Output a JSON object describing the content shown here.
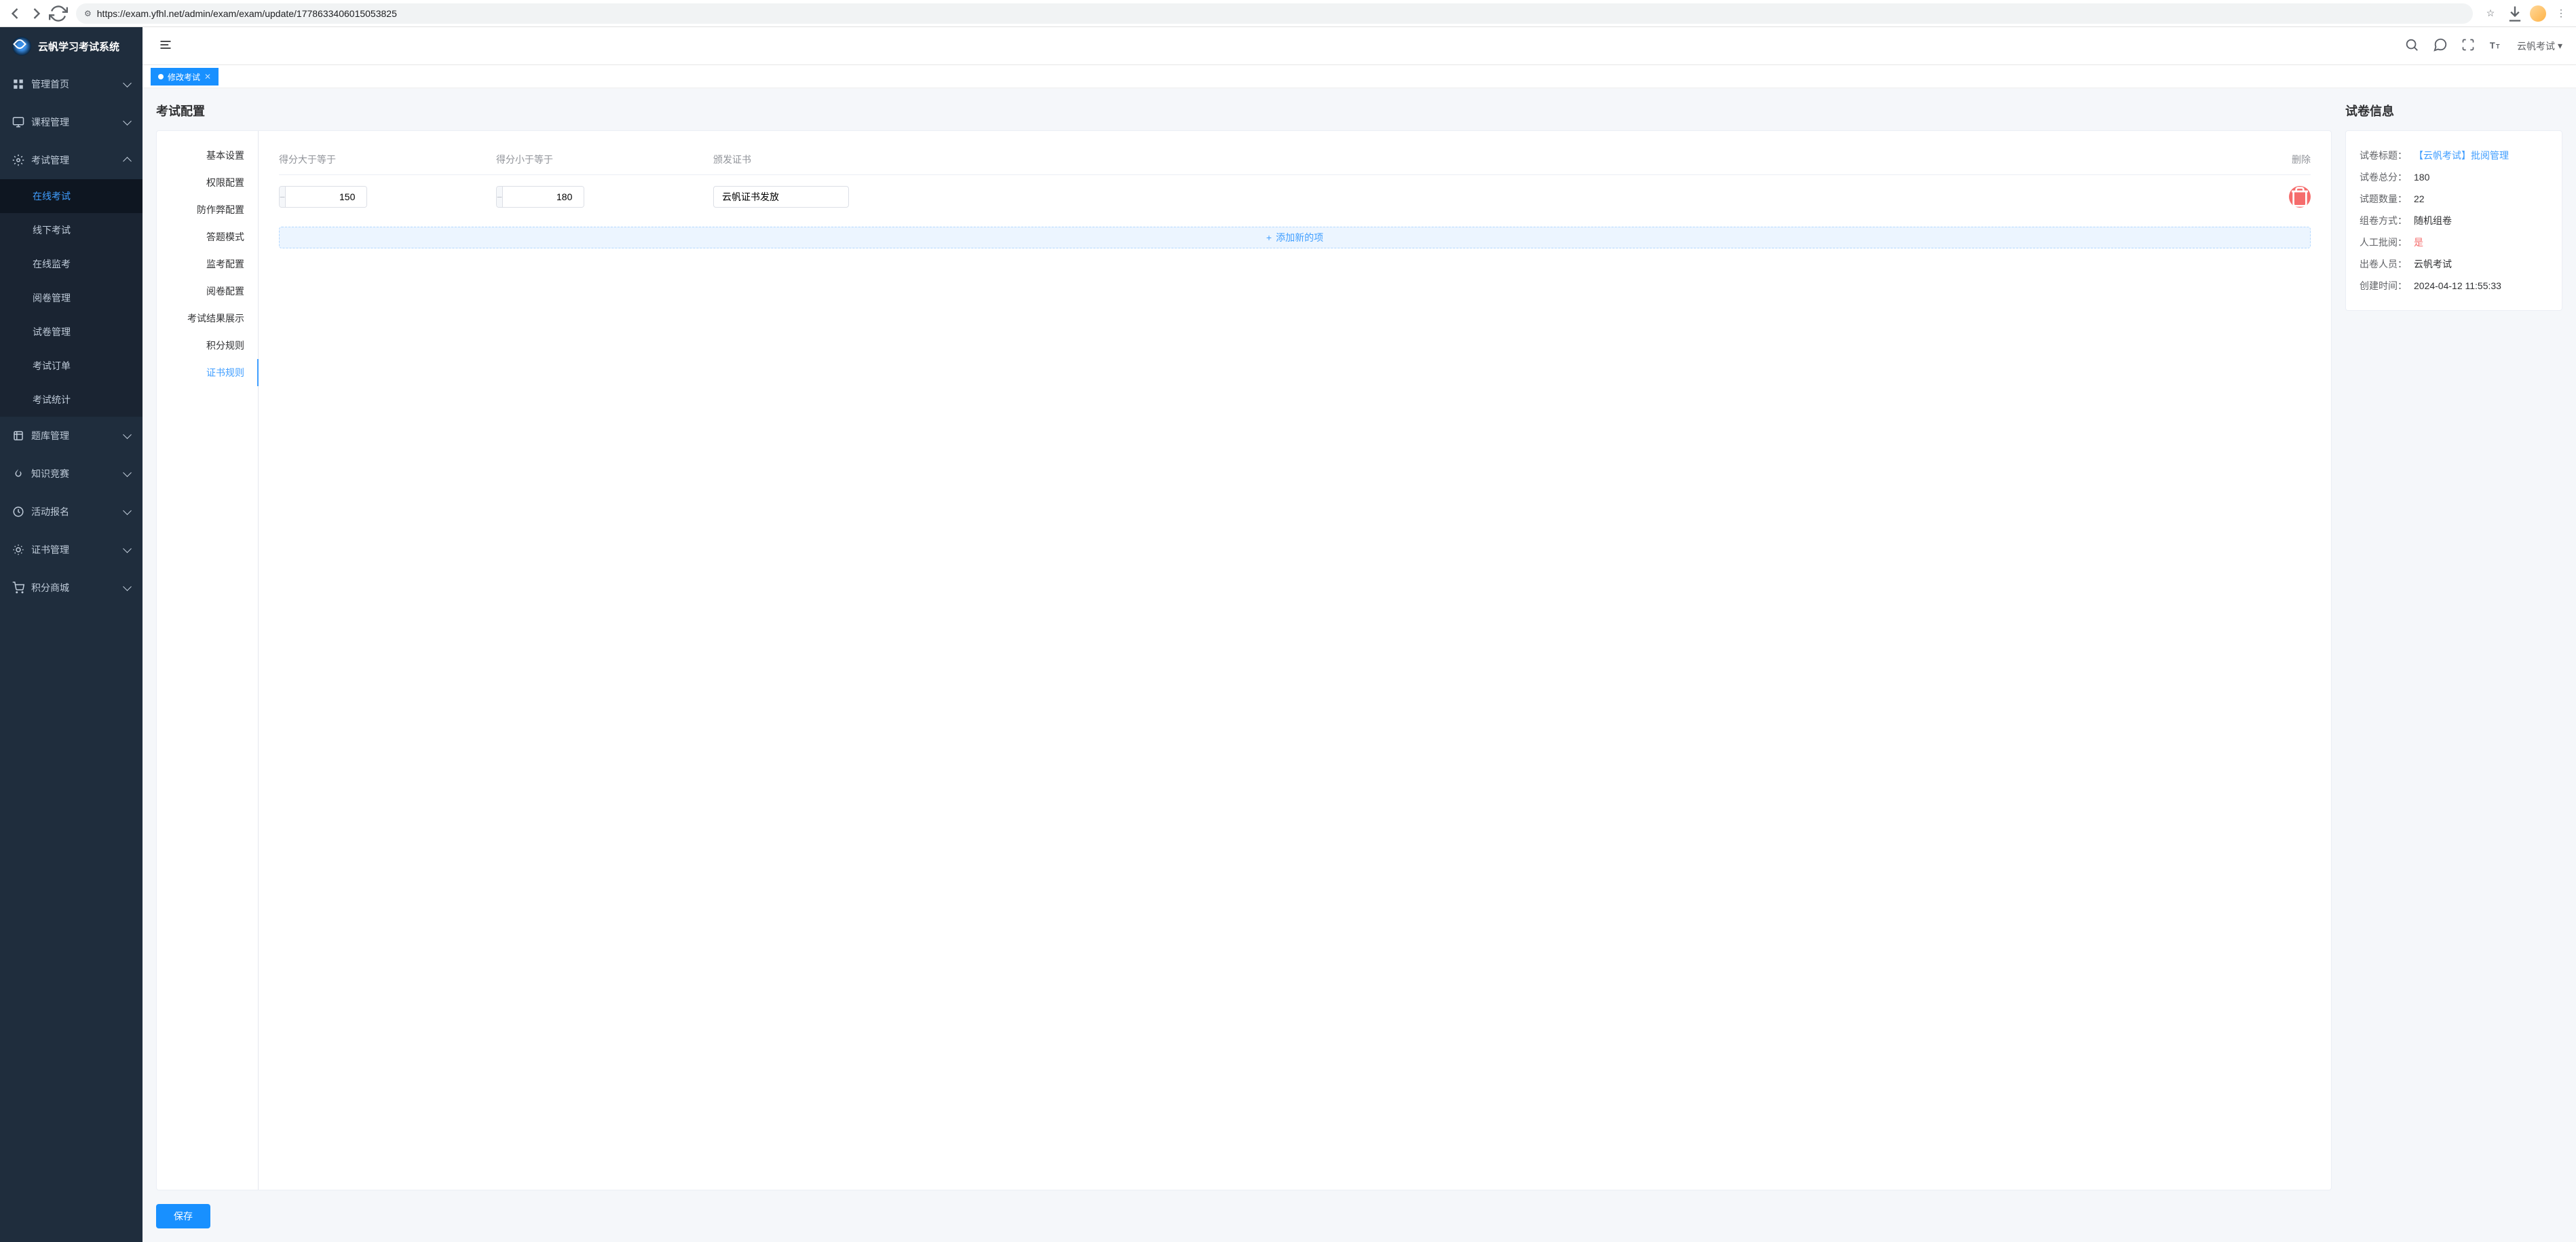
{
  "browser": {
    "url": "https://exam.yfhl.net/admin/exam/exam/update/1778633406015053825"
  },
  "app_title": "云帆学习考试系统",
  "header": {
    "username": "云帆考试"
  },
  "tabs": [
    {
      "label": "修改考试",
      "active": true
    }
  ],
  "sidebar": {
    "items": [
      {
        "id": "dashboard",
        "label": "管理首页",
        "icon": "grid"
      },
      {
        "id": "course",
        "label": "课程管理",
        "icon": "monitor"
      },
      {
        "id": "exam",
        "label": "考试管理",
        "icon": "gear",
        "expanded": true,
        "children": [
          {
            "id": "online-exam",
            "label": "在线考试",
            "active": true
          },
          {
            "id": "offline-exam",
            "label": "线下考试"
          },
          {
            "id": "online-proctor",
            "label": "在线监考"
          },
          {
            "id": "marking",
            "label": "阅卷管理"
          },
          {
            "id": "paper-mgmt",
            "label": "试卷管理"
          },
          {
            "id": "exam-orders",
            "label": "考试订单"
          },
          {
            "id": "exam-stats",
            "label": "考试统计"
          }
        ]
      },
      {
        "id": "question-bank",
        "label": "题库管理",
        "icon": "stack"
      },
      {
        "id": "competition",
        "label": "知识竞赛",
        "icon": "fire"
      },
      {
        "id": "activity",
        "label": "活动报名",
        "icon": "clock"
      },
      {
        "id": "certificate",
        "label": "证书管理",
        "icon": "sun"
      },
      {
        "id": "mall",
        "label": "积分商城",
        "icon": "cart"
      }
    ]
  },
  "page": {
    "title": "考试配置",
    "config_tabs": [
      {
        "id": "basic",
        "label": "基本设置"
      },
      {
        "id": "perm",
        "label": "权限配置"
      },
      {
        "id": "anti-cheat",
        "label": "防作弊配置"
      },
      {
        "id": "answer-mode",
        "label": "答题模式"
      },
      {
        "id": "proctor",
        "label": "监考配置"
      },
      {
        "id": "marking",
        "label": "阅卷配置"
      },
      {
        "id": "result",
        "label": "考试结果展示"
      },
      {
        "id": "points",
        "label": "积分规则"
      },
      {
        "id": "cert",
        "label": "证书规则",
        "active": true
      }
    ],
    "cert_rules": {
      "headers": {
        "min": "得分大于等于",
        "max": "得分小于等于",
        "cert": "颁发证书",
        "del": "删除"
      },
      "rows": [
        {
          "min": "150",
          "max": "180",
          "cert": "云帆证书发放"
        }
      ],
      "add_label": "添加新的项"
    },
    "save_label": "保存"
  },
  "info": {
    "title": "试卷信息",
    "rows": [
      {
        "label": "试卷标题：",
        "value": "【云帆考试】批阅管理",
        "style": "link"
      },
      {
        "label": "试卷总分：",
        "value": "180"
      },
      {
        "label": "试题数量：",
        "value": "22"
      },
      {
        "label": "组卷方式：",
        "value": "随机组卷"
      },
      {
        "label": "人工批阅：",
        "value": "是",
        "style": "danger"
      },
      {
        "label": "出卷人员：",
        "value": "云帆考试"
      },
      {
        "label": "创建时间：",
        "value": "2024-04-12 11:55:33"
      }
    ]
  }
}
